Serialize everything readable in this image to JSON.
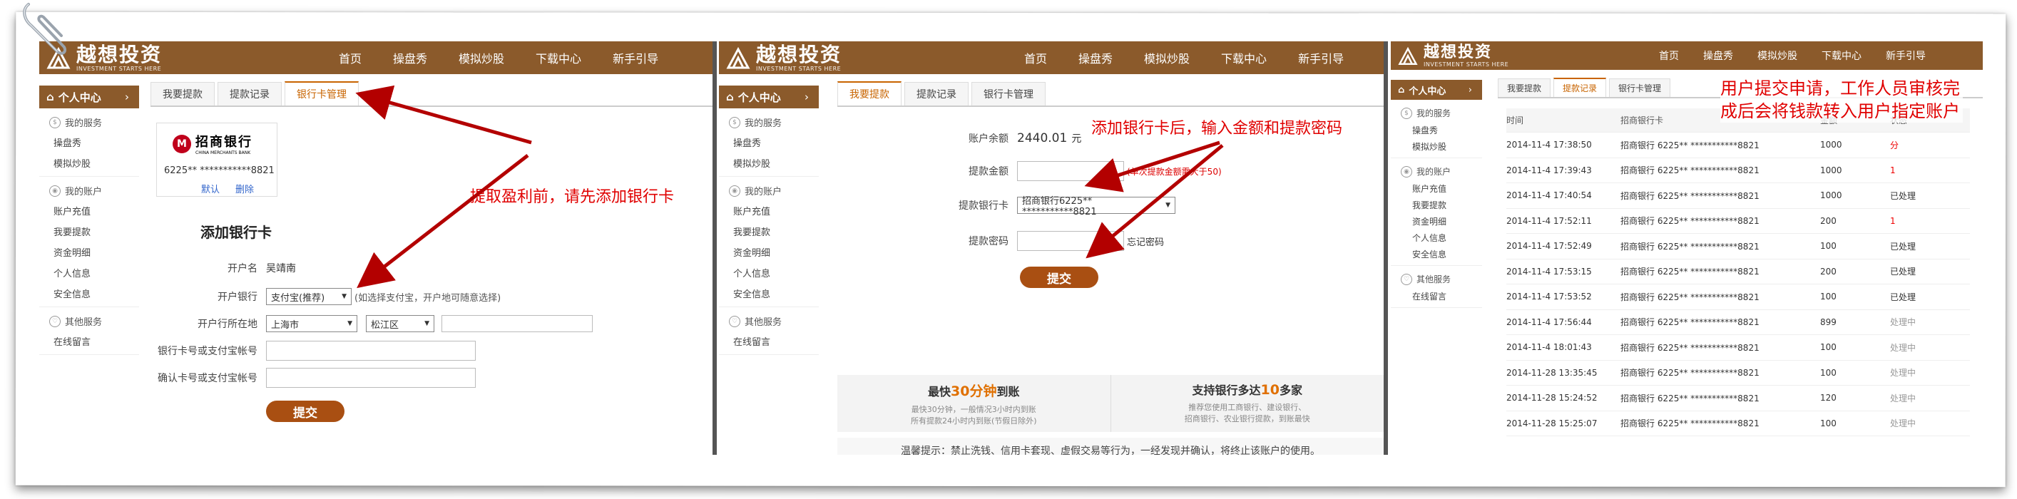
{
  "brand": {
    "name": "越想投资",
    "tagline": "INVESTMENT STARTS HERE"
  },
  "nav": [
    "首页",
    "操盘秀",
    "模拟炒股",
    "下载中心",
    "新手引导"
  ],
  "sidebar": {
    "header": "个人中心",
    "header_arrow": "›",
    "groups": [
      {
        "title": "我的服务",
        "items": [
          "操盘秀",
          "模拟炒股"
        ]
      },
      {
        "title": "我的账户",
        "items": [
          "账户充值",
          "我要提款",
          "资金明细",
          "个人信息",
          "安全信息"
        ]
      },
      {
        "title": "其他服务",
        "items": [
          "在线留言"
        ]
      }
    ]
  },
  "tabs": [
    "我要提款",
    "提款记录",
    "银行卡管理"
  ],
  "panel1": {
    "card": {
      "bank_name": "招商银行",
      "bank_en": "CHINA MERCHANTS BANK",
      "bank_logo": "M",
      "number": "6225** ***********8821",
      "default_link": "默认",
      "delete_link": "删除"
    },
    "form_title": "添加银行卡",
    "holder_label": "开户名",
    "holder_value": "吴靖南",
    "bank_label": "开户银行",
    "bank_value": "支付宝(推荐)",
    "bank_hint": "(如选择支付宝，开户地可随意选择)",
    "region_label": "开户行所在地",
    "province": "上海市",
    "district": "松江区",
    "account_label": "银行卡号或支付宝帐号",
    "confirm_label": "确认卡号或支付宝帐号",
    "submit": "提交",
    "annotation": "提取盈利前，请先添加银行卡"
  },
  "panel2": {
    "balance_label": "账户余额",
    "balance_value": "2440.01",
    "balance_unit": "元",
    "amount_label": "提款金额",
    "amount_hint": "(单次提款金额需大于50)",
    "card_label": "提款银行卡",
    "card_value": "招商银行6225** ***********8821",
    "password_label": "提款密码",
    "forgot": "忘记密码",
    "submit": "提交",
    "feature1_pre": "最快",
    "feature1_hl": "30分钟",
    "feature1_post": "到账",
    "feature1_desc1": "最快30分钟，一般情况3小时内到账",
    "feature1_desc2": "所有提款24小时内到账(节假日除外)",
    "feature2_pre": "支持银行多达",
    "feature2_hl": "10",
    "feature2_post": "多家",
    "feature2_desc1": "推荐您使用工商银行、建设银行、",
    "feature2_desc2": "招商银行、农业银行提款，到账最快",
    "notice": "温馨提示：禁止洗钱、信用卡套现、虚假交易等行为，一经发现并确认，将终止该账户的使用。",
    "annotation": "添加银行卡后，输入金额和提款密码"
  },
  "panel3": {
    "headers": [
      "时间",
      "招商银行卡",
      "金额",
      "状态"
    ],
    "rows": [
      [
        "2014-11-4 17:38:50",
        "招商银行 6225** ***********8821",
        "1000",
        "分"
      ],
      [
        "2014-11-4 17:39:43",
        "招商银行 6225** ***********8821",
        "1000",
        "1"
      ],
      [
        "2014-11-4 17:40:54",
        "招商银行 6225** ***********8821",
        "1000",
        "已处理"
      ],
      [
        "2014-11-4 17:52:11",
        "招商银行 6225** ***********8821",
        "200",
        "1"
      ],
      [
        "2014-11-4 17:52:49",
        "招商银行 6225** ***********8821",
        "100",
        "已处理"
      ],
      [
        "2014-11-4 17:53:15",
        "招商银行 6225** ***********8821",
        "200",
        "已处理"
      ],
      [
        "2014-11-4 17:53:52",
        "招商银行 6225** ***********8821",
        "100",
        "已处理"
      ],
      [
        "2014-11-4 17:56:44",
        "招商银行 6225** ***********8821",
        "899",
        "处理中"
      ],
      [
        "2014-11-4 18:01:43",
        "招商银行 6225** ***********8821",
        "100",
        "处理中"
      ],
      [
        "2014-11-28 13:35:45",
        "招商银行 6225** ***********8821",
        "100",
        "处理中"
      ],
      [
        "2014-11-28 15:24:52",
        "招商银行 6225** ***********8821",
        "120",
        "处理中"
      ],
      [
        "2014-11-28 15:25:07",
        "招商银行 6225** ***********8821",
        "100",
        "处理中"
      ]
    ],
    "annotation": "用户提交申请，工作人员审核完成后会将钱款转入用户指定账户"
  },
  "colors": {
    "brand": "#8b5a2b",
    "accent": "#c86400",
    "annotation": "#e00000",
    "button": "#a94f12"
  }
}
